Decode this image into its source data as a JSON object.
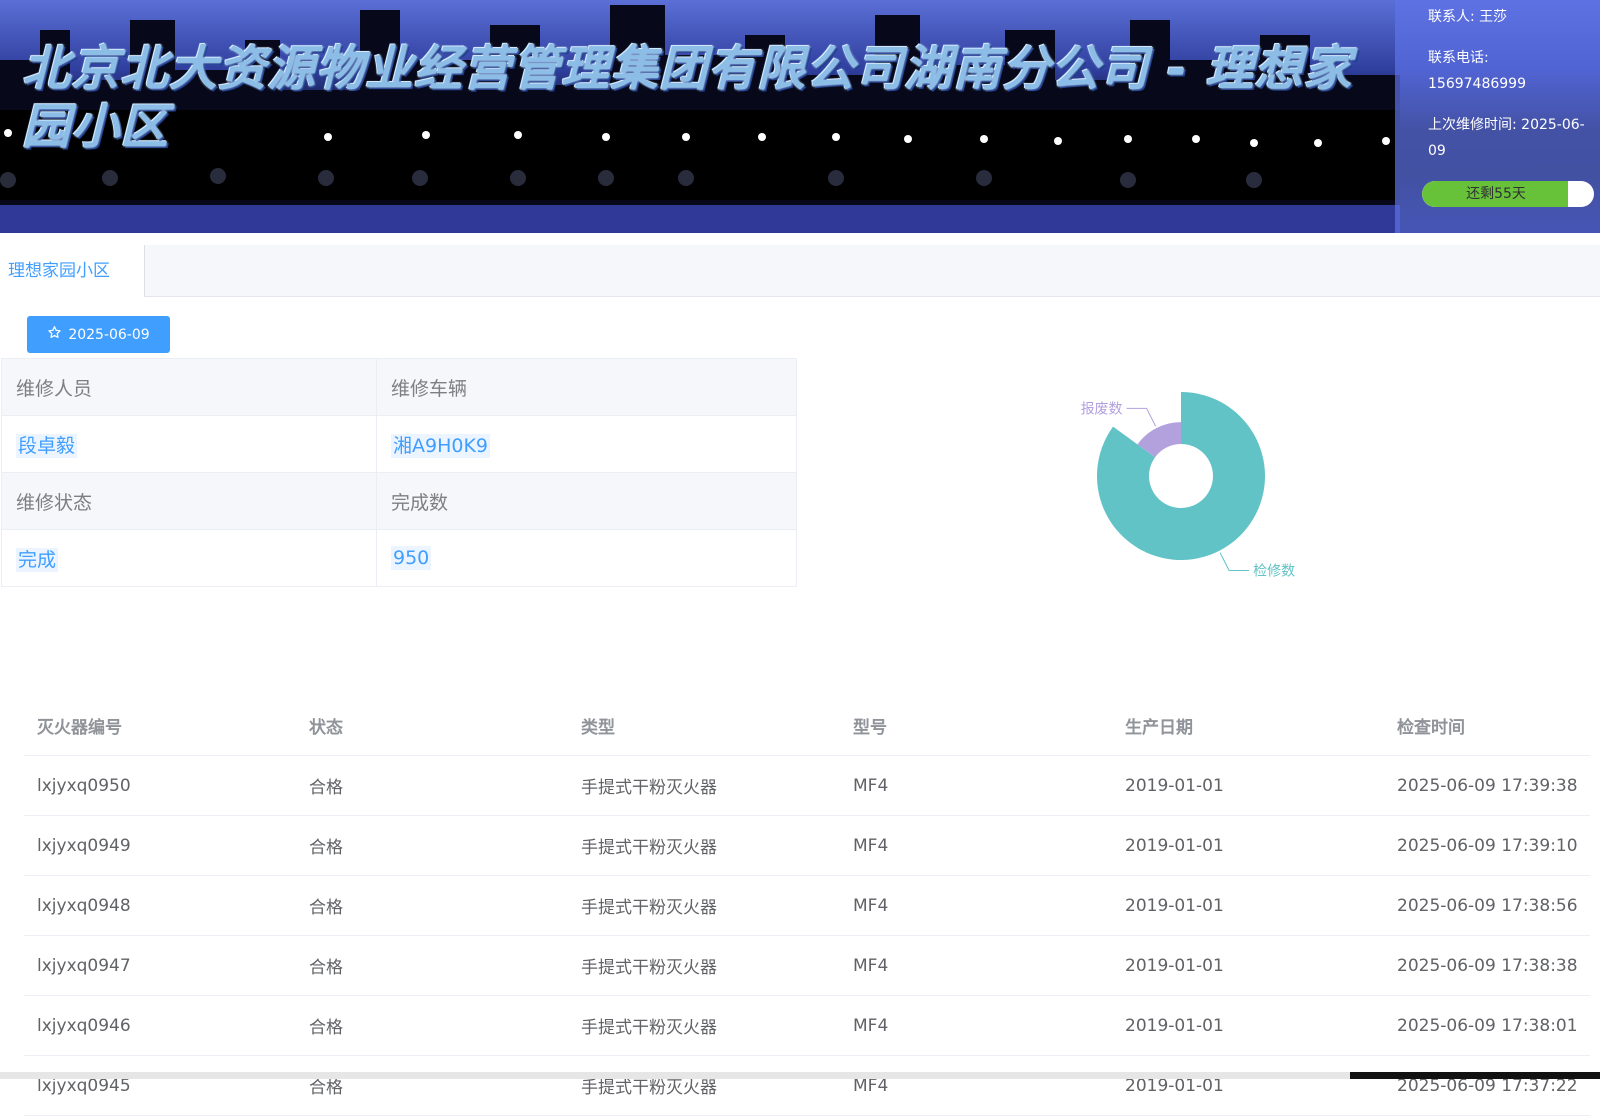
{
  "header": {
    "title": "北京北大资源物业经营管理集团有限公司湖南分公司 - 理想家园小区",
    "contact_label": "联系人: 王莎",
    "phone_label": "联系电话:",
    "phone": "15697486999",
    "last_maintenance": "上次维修时间: 2025-06-09",
    "remaining": "还剩55天",
    "remaining_fraction": 0.85
  },
  "tabs": [
    {
      "label": "理想家园小区",
      "active": true
    }
  ],
  "date_button": {
    "label": "2025-06-09",
    "icon": "star-icon"
  },
  "info": {
    "staff_label": "维修人员",
    "vehicle_label": "维修车辆",
    "staff": "段卓毅",
    "vehicle": "湘A9H0K9",
    "status_label": "维修状态",
    "count_label": "完成数",
    "status": "完成",
    "count": "950"
  },
  "chart_data": {
    "type": "pie",
    "donut": true,
    "slices": [
      {
        "name": "检修数",
        "value": 850,
        "color": "#62c3c6"
      },
      {
        "name": "报废数",
        "value": 150,
        "color": "#b3a1de"
      }
    ]
  },
  "table": {
    "headers": [
      "灭火器编号",
      "状态",
      "类型",
      "型号",
      "生产日期",
      "检查时间"
    ],
    "rows": [
      [
        "lxjyxq0950",
        "合格",
        "手提式干粉灭火器",
        "MF4",
        "2019-01-01",
        "2025-06-09 17:39:38"
      ],
      [
        "lxjyxq0949",
        "合格",
        "手提式干粉灭火器",
        "MF4",
        "2019-01-01",
        "2025-06-09 17:39:10"
      ],
      [
        "lxjyxq0948",
        "合格",
        "手提式干粉灭火器",
        "MF4",
        "2019-01-01",
        "2025-06-09 17:38:56"
      ],
      [
        "lxjyxq0947",
        "合格",
        "手提式干粉灭火器",
        "MF4",
        "2019-01-01",
        "2025-06-09 17:38:38"
      ],
      [
        "lxjyxq0946",
        "合格",
        "手提式干粉灭火器",
        "MF4",
        "2019-01-01",
        "2025-06-09 17:38:01"
      ],
      [
        "lxjyxq0945",
        "合格",
        "手提式干粉灭火器",
        "MF4",
        "2019-01-01",
        "2025-06-09 17:37:22"
      ]
    ]
  },
  "colors": {
    "accent": "#409eff",
    "progress": "#67c23a",
    "title": "#8bbde6"
  }
}
